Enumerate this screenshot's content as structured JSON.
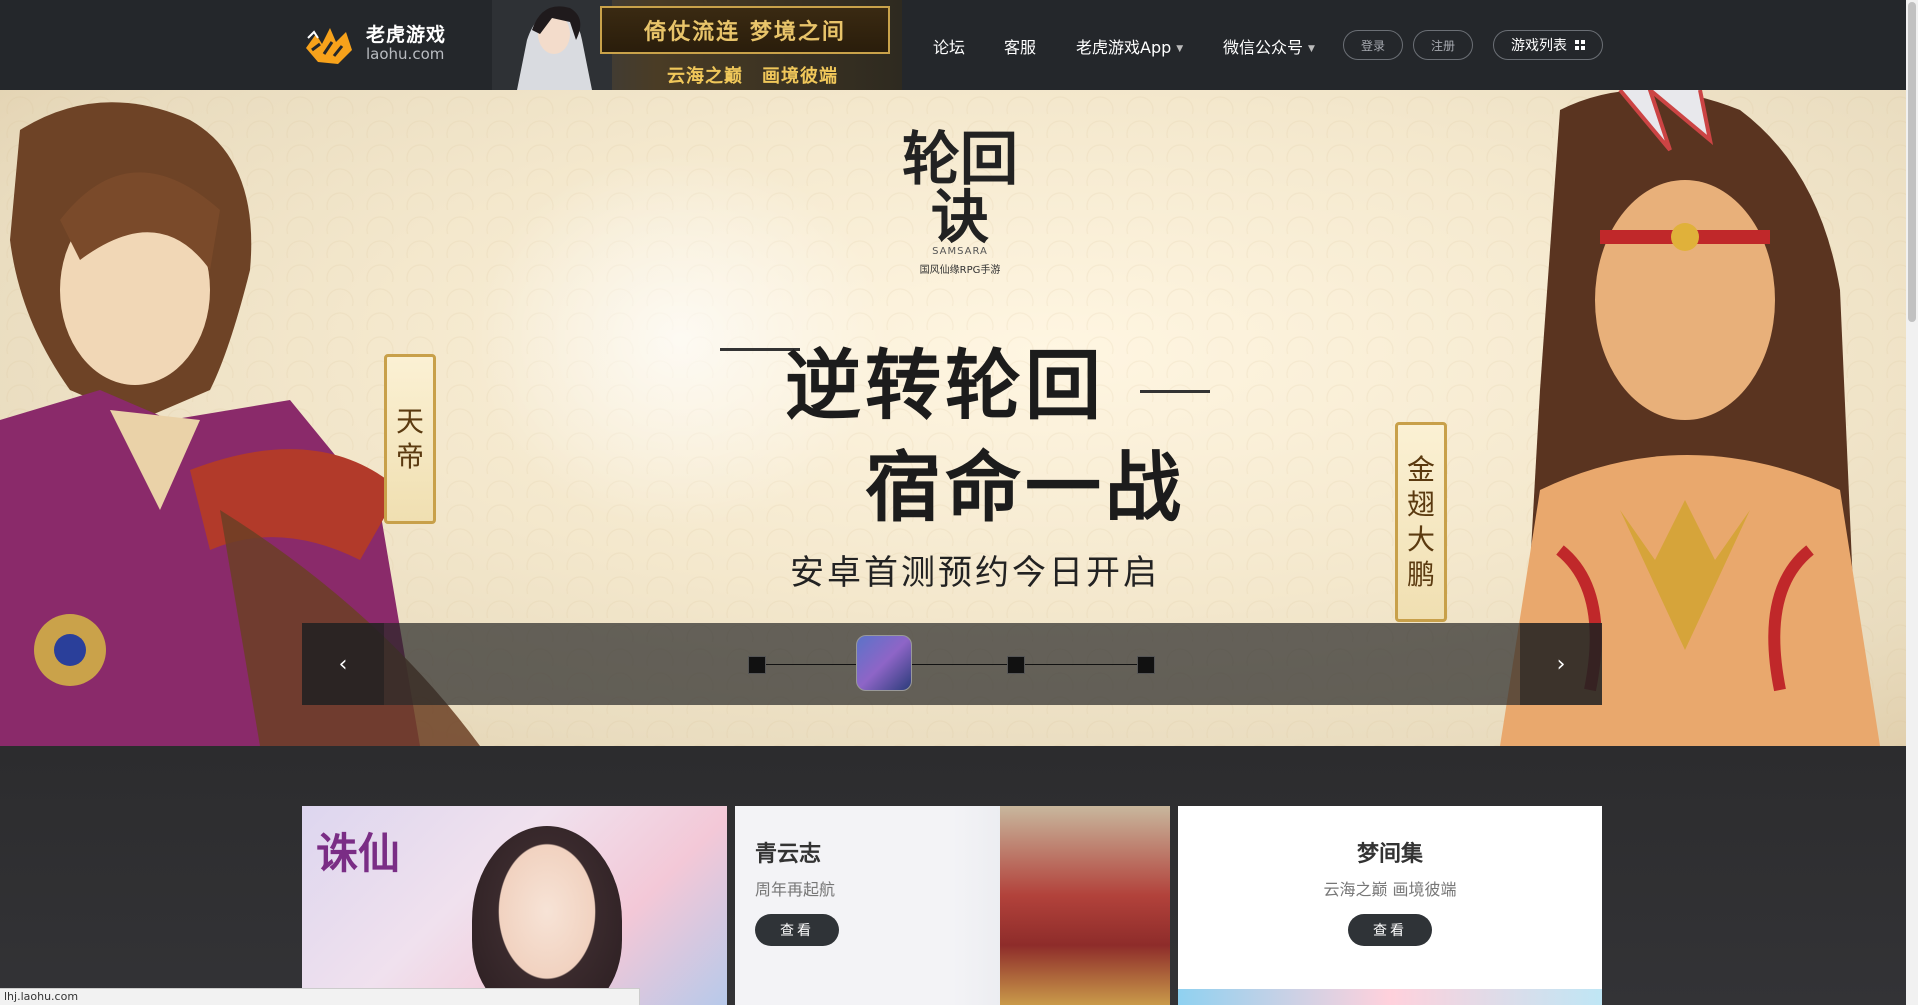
{
  "header": {
    "logo_name": "老虎游戏",
    "logo_domain": "laohu.com",
    "banner_title": "倚仗流连 梦境之间",
    "banner_sub": "云海之巅　画境彼端",
    "nav": {
      "forum": "论坛",
      "service": "客服",
      "app": "老虎游戏App",
      "wechat": "微信公众号"
    },
    "login": "登录",
    "register": "注册",
    "game_list": "游戏列表"
  },
  "hero": {
    "game_logo": "轮回诀",
    "game_logo_en": "SAMSARA",
    "game_logo_tag": "国风仙缘RPG手游",
    "slogan_line1": "逆转轮回",
    "slogan_line2": "宿命一战",
    "subtitle": "安卓首测预约今日开启",
    "plaque_left": [
      "天",
      "帝"
    ],
    "plaque_right": [
      "金",
      "翅",
      "大",
      "鹏"
    ],
    "prev": "‹",
    "next": "›"
  },
  "cards": {
    "main_title": "诛仙",
    "mid_title": "青云志",
    "mid_sub": "周年再起航",
    "mid_button": "查看",
    "right_title": "梦间集",
    "right_sub": "云海之巅 画境彼端",
    "right_button": "查看"
  },
  "status_url": "lhj.laohu.com",
  "colors": {
    "header_bg": "#24272b",
    "content_bg": "#2c2c2e",
    "button_dark": "#2f3337"
  }
}
